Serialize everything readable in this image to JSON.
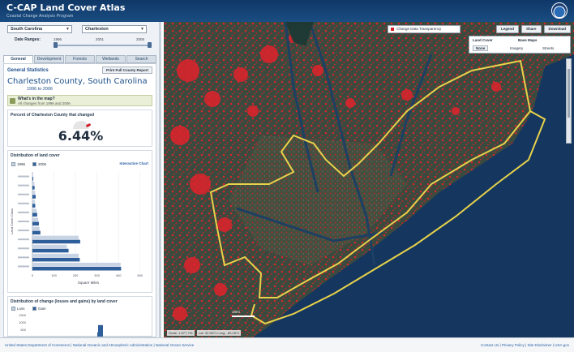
{
  "header": {
    "title": "C-CAP Land Cover Atlas",
    "subtitle": "Coastal Change Analysis Program"
  },
  "left": {
    "state_select": "South Carolina",
    "county_select": "Charleston",
    "date_range_label": "Date Ranges:",
    "years": [
      "1996",
      "2001",
      "2006"
    ],
    "slider": {
      "start": 0.0,
      "end": 1.0
    },
    "tabs": [
      "General",
      "Development",
      "Forests",
      "Wetlands",
      "Search"
    ],
    "active_tab": "General",
    "general_stats_title": "General Statistics",
    "print_button": "Print Full County Report",
    "county_name": "Charleston County, South Carolina",
    "years_span": "1996 to 2006",
    "whats_question": "What's in the map?",
    "whats_sub": "All changes from 1996 and 2006",
    "percent_card_title": "Percent of Charleston County that changed",
    "percent_value": "6.44%",
    "percent_fraction": 0.0644,
    "dist_title": "Distribution of land cover",
    "legend": [
      "1996",
      "2006"
    ],
    "interactive_chart": "Interactive Chart",
    "change_title": "Distribution of change (losses and gains) by land cover",
    "change_legend": [
      "Loss",
      "Gain"
    ],
    "change_axis": [
      "1500",
      "1000",
      "500"
    ]
  },
  "chart_data": [
    {
      "type": "bar",
      "title": "Distribution of land cover",
      "xlabel": "Square Miles",
      "ylabel": "Land Cover Class",
      "x_ticks": [
        "0",
        "100",
        "200",
        "300",
        "400",
        "500"
      ],
      "y_ticks": [
        "",
        "",
        "",
        "",
        "",
        "",
        "",
        "",
        "",
        "",
        ""
      ],
      "categories": [
        "",
        "",
        "",
        "",
        "",
        "",
        "",
        "",
        "",
        "",
        ""
      ],
      "xlim": [
        0,
        520
      ],
      "series": [
        {
          "name": "1996",
          "values": [
            3,
            9,
            13,
            12,
            20,
            27,
            33,
            215,
            160,
            215,
            410
          ]
        },
        {
          "name": "2006",
          "values": [
            4,
            10,
            15,
            13,
            22,
            30,
            37,
            222,
            168,
            220,
            412
          ]
        }
      ]
    },
    {
      "type": "bar",
      "title": "Distribution of change (losses and gains) by land cover",
      "categories": [
        "",
        ""
      ],
      "series": [
        {
          "name": "Loss",
          "values": [
            250,
            600
          ]
        },
        {
          "name": "Gain",
          "values": [
            0,
            0
          ]
        }
      ],
      "ylim": [
        0,
        1500
      ]
    }
  ],
  "map": {
    "change_toggle": "Change Data Transparency",
    "buttons": [
      "Legend",
      "Share",
      "Download"
    ],
    "land_cover_label": "Land Cover",
    "land_cover_value": "None",
    "base_maps_label": "Base Maps",
    "base_map_options": [
      "Imagery",
      "Streets"
    ],
    "scale_label": "10mi",
    "scale_label_2": "5mi",
    "coord_scale": "Scale: 1:577,791",
    "coord_latlon": "Lat: 32.5871 Long: -80.2871"
  },
  "footer": {
    "left": "United States Department of Commerce | National Oceanic and Atmospheric Administration | National Ocean Service",
    "right": "Contact Us | Privacy Policy | Site Disclaimer | USA.gov"
  },
  "colors": {
    "header_bg": "#0f3766",
    "accent": "#1d4f8a",
    "change_red": "#e0232c",
    "county_outline": "#e8d24a",
    "bar_1996": "#c8d4e3",
    "bar_2006": "#2f5f9a"
  }
}
